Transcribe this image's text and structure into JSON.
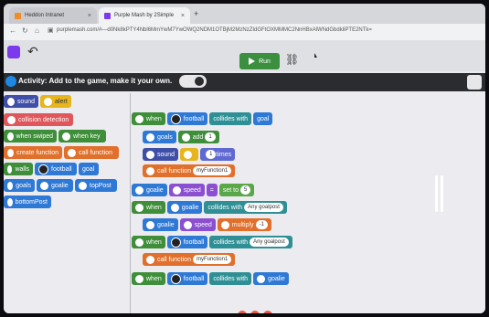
{
  "browser": {
    "tabs": [
      {
        "label": "Heddon Intranet",
        "close": "×"
      },
      {
        "label": "Purple Mash by 2Simple",
        "close": "×"
      }
    ],
    "new_tab": "+",
    "url": "purplemash.com/#—d0Nk8kPTY4Nbl6MmYwM7YwOWQ2NDM1OTBjM2MzNzZIdGFtOXMMMC2NnHBxAlWNdGbdkliPTE2NTk="
  },
  "toolbar": {
    "run_label": "Run"
  },
  "activity": {
    "text": "Activity: Add to the game, make it your own."
  },
  "palette": [
    {
      "text": "sound",
      "color": "#3f4fa8"
    },
    {
      "text": "alert",
      "color": "#e7b51c"
    },
    {
      "text": "collision detection",
      "color": "#e0575b"
    },
    {
      "text": "when swiped",
      "color": "#3e8e3a"
    },
    {
      "text": "when key",
      "color": "#3e8e3a"
    },
    {
      "text": "create function",
      "color": "#e0702b"
    },
    {
      "text": "call function",
      "color": "#e0702b"
    },
    {
      "text": "walls",
      "color": "#3e8e3a"
    },
    {
      "text": "football",
      "color": "#2e78d6"
    },
    {
      "text": "goal",
      "color": "#2e78d6"
    },
    {
      "text": "goals",
      "color": "#2e78d6"
    },
    {
      "text": "goalie",
      "color": "#2e78d6"
    },
    {
      "text": "topPost",
      "color": "#2e78d6"
    },
    {
      "text": "bottomPost",
      "color": "#2e78d6"
    }
  ],
  "code_rows": [
    {
      "parts": [
        "when",
        "football",
        "collides with",
        "goal"
      ]
    },
    {
      "parts": [
        "goals",
        "add",
        "1"
      ]
    },
    {
      "parts": [
        "sound",
        "1",
        "times"
      ]
    },
    {
      "parts": [
        "call function",
        "myFunction1"
      ]
    },
    {
      "parts": [
        "goalie",
        "speed",
        "=",
        "set to",
        "5"
      ]
    },
    {
      "parts": [
        "when",
        "goalie",
        "collides with",
        "Any goalpost"
      ]
    },
    {
      "parts": [
        "goalie",
        "speed",
        "multiply",
        "-1"
      ]
    },
    {
      "parts": [
        "when",
        "football",
        "collides with",
        "Any goalpost"
      ]
    },
    {
      "parts": [
        "call function",
        "myFunction1"
      ]
    },
    {
      "parts": [
        "when",
        "football",
        "collides with",
        "goalie"
      ]
    }
  ]
}
